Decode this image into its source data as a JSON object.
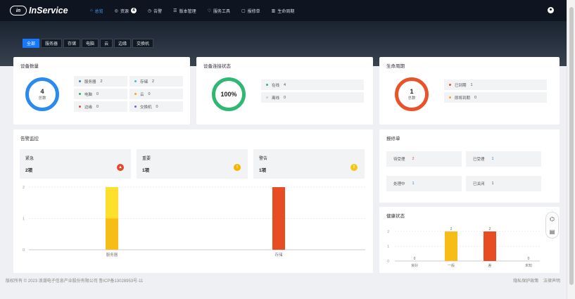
{
  "brand": {
    "mark": "in",
    "name": "InService"
  },
  "nav": [
    {
      "icon": "⌂",
      "icon_name": "home-icon",
      "label": "总览",
      "active": true
    },
    {
      "icon": "◎",
      "icon_name": "resource-icon",
      "label": "资源",
      "badge": "4"
    },
    {
      "icon": "◷",
      "icon_name": "alarm-icon",
      "label": "告警"
    },
    {
      "icon": "☰",
      "icon_name": "list-icon",
      "label": "版本管理"
    },
    {
      "icon": "♡",
      "icon_name": "tool-icon",
      "label": "服务工具"
    },
    {
      "icon": "▢",
      "icon_name": "ticket-icon",
      "label": "报修单"
    },
    {
      "icon": "▥",
      "icon_name": "lifecycle-icon",
      "label": "生命周期"
    }
  ],
  "filters": [
    "全部",
    "服务器",
    "存储",
    "电脑",
    "云",
    "边缘",
    "交换机"
  ],
  "device_count": {
    "title": "设备数量",
    "total": "4",
    "total_label": "总数",
    "items": [
      {
        "label": "服务器",
        "value": "2",
        "color": "#2a7de1"
      },
      {
        "label": "存储",
        "value": "2",
        "color": "#37c3d4"
      },
      {
        "label": "电脑",
        "value": "0",
        "color": "#2ea96a"
      },
      {
        "label": "云",
        "value": "0",
        "color": "#f5a623"
      },
      {
        "label": "边缘",
        "value": "0",
        "color": "#e8453c"
      },
      {
        "label": "交换机",
        "value": "0",
        "color": "#7b5cd6"
      }
    ]
  },
  "connection": {
    "title": "设备连接状态",
    "percent": "100%",
    "items": [
      {
        "label": "在线",
        "value": "4",
        "color": "#2eb872"
      },
      {
        "label": "离线",
        "value": "0",
        "color": "#d0d0d0"
      }
    ]
  },
  "lifecycle": {
    "title": "生命周期",
    "total": "1",
    "total_label": "总数",
    "items": [
      {
        "label": "已到期",
        "value": "1",
        "color": "#e8532a"
      },
      {
        "label": "即将到期",
        "value": "0",
        "color": "#f5a623"
      }
    ]
  },
  "alerts": {
    "title": "告警监控",
    "cards": [
      {
        "name": "紧急",
        "value": "2项",
        "color": "#e8452a",
        "icon": "▲"
      },
      {
        "name": "重要",
        "value": "1项",
        "color": "#f5b400",
        "icon": "!"
      },
      {
        "name": "警告",
        "value": "1项",
        "color": "#f5c518",
        "icon": "!"
      }
    ]
  },
  "tickets": {
    "title": "报修单",
    "items": [
      {
        "label": "待受理",
        "value": "2",
        "color": "#e8453c"
      },
      {
        "label": "已受理",
        "value": "1",
        "color": "#2a7de1"
      },
      {
        "label": "处理中",
        "value": "1",
        "color": "#2a7de1"
      },
      {
        "label": "已关闭",
        "value": "1",
        "color": "#555555"
      }
    ]
  },
  "health_title": "健康状态",
  "chart_data": [
    {
      "type": "bar",
      "stacked": true,
      "categories": [
        "服务器",
        "存储"
      ],
      "series": [
        {
          "values": [
            1,
            0
          ],
          "color": "#f6bd16"
        },
        {
          "values": [
            1,
            0
          ],
          "color": "#fde02c"
        },
        {
          "values": [
            0,
            2
          ],
          "color": "#e84c23"
        }
      ],
      "ylim": [
        0,
        2
      ],
      "yticks": [
        0,
        1,
        2
      ],
      "grid": true
    },
    {
      "type": "bar",
      "categories": [
        "良好",
        "一般",
        "差",
        "未知"
      ],
      "values": [
        0,
        2,
        2,
        0
      ],
      "colors": [
        "#2a7de1",
        "#f6bd16",
        "#e84c23",
        "#aaaaaa"
      ],
      "data_labels": [
        "0",
        "2",
        "2",
        "0"
      ],
      "ylim": [
        0,
        2
      ],
      "yticks": [
        0,
        1,
        2
      ],
      "grid": true
    }
  ],
  "footer": {
    "copyright": "版权所有 © 2023 浪潮电子信息产业股份有限公司 鲁ICP备13028953号-11",
    "privacy": "隐私保护政策",
    "legal": "法律声明"
  },
  "float_tools": {
    "headset_icon": "⌬",
    "doc_icon": "▤"
  }
}
